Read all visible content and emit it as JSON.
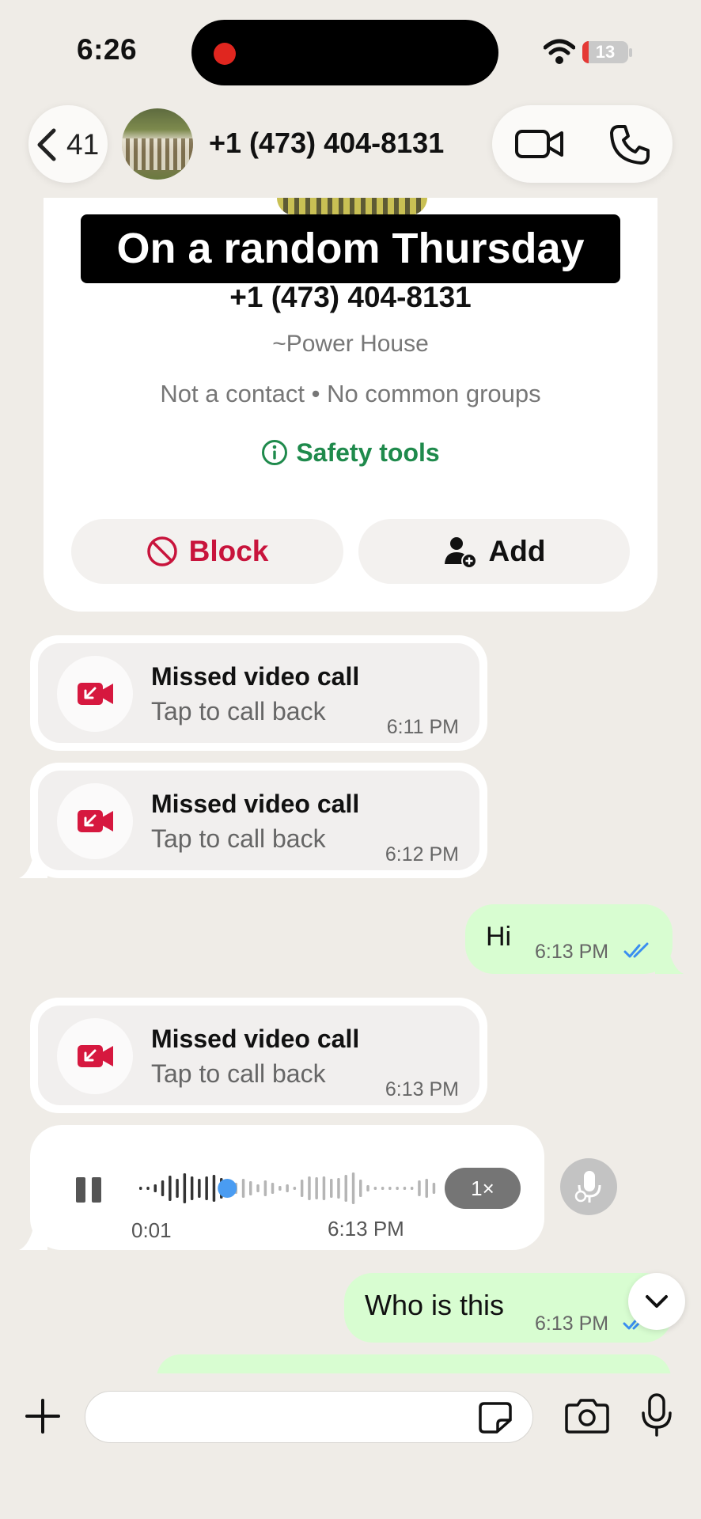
{
  "status_bar": {
    "time": "6:26",
    "battery": "13"
  },
  "header": {
    "back_count": "41",
    "phone": "+1 (473) 404-8131",
    "video_icon": "video-camera-icon",
    "call_icon": "phone-icon"
  },
  "caption": "On a random Thursday",
  "profile_card": {
    "phone": "+1 (473) 404-8131",
    "alias": "~Power House",
    "info": "Not a contact • No common groups",
    "safety_label": "Safety tools",
    "block_label": "Block",
    "add_label": "Add"
  },
  "messages": [
    {
      "type": "missed_call",
      "title": "Missed video call",
      "subtitle": "Tap to call back",
      "time": "6:11 PM"
    },
    {
      "type": "missed_call",
      "title": "Missed video call",
      "subtitle": "Tap to call back",
      "time": "6:12 PM"
    },
    {
      "type": "outgoing",
      "text": "Hi",
      "time": "6:13 PM",
      "status": "read"
    },
    {
      "type": "missed_call",
      "title": "Missed video call",
      "subtitle": "Tap to call back",
      "time": "6:13 PM"
    },
    {
      "type": "voice",
      "elapsed": "0:01",
      "time": "6:13 PM",
      "speed": "1×",
      "progress": 0.3
    },
    {
      "type": "outgoing",
      "text": "Who is this",
      "time": "6:13 PM",
      "status": "read"
    }
  ],
  "colors": {
    "background": "#efece7",
    "outgoing_bubble": "#d8fdd1",
    "missed_icon": "#d6183f",
    "block_red": "#c8143c",
    "safety_green": "#1f8a4c",
    "read_tick": "#3a8ef0"
  }
}
